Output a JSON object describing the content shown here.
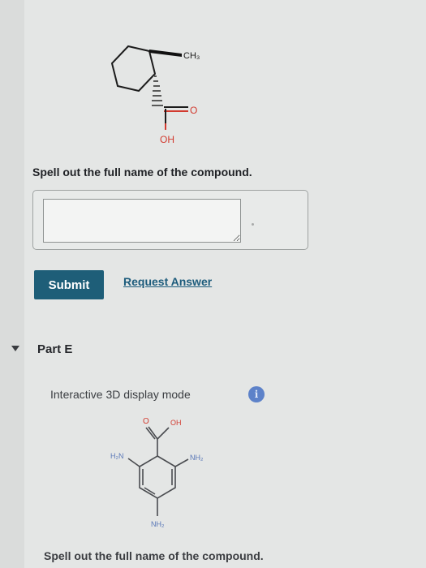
{
  "structure1": {
    "methyl_label": "CH₃",
    "carbonyl_label": "O",
    "hydroxyl_label": "OH"
  },
  "question": {
    "prompt": "Spell out the full name of the compound.",
    "answer_value": "",
    "submit_label": "Submit",
    "request_answer_label": "Request Answer"
  },
  "part_e": {
    "title": "Part E",
    "mode_label": "Interactive 3D display mode",
    "info_icon": "info-icon",
    "structure2": {
      "carbonyl_label": "O",
      "hydroxyl_label": "OH",
      "amine_left_label": "H₂N",
      "amine_right_label": "NH₂",
      "amine_bottom_label": "NH₂"
    },
    "prompt": "Spell out the full name of the compound."
  },
  "colors": {
    "submit_bg": "#1e5e78",
    "link": "#1d5c7c",
    "info": "#5d82c9",
    "oxygen": "#d23a2f"
  }
}
